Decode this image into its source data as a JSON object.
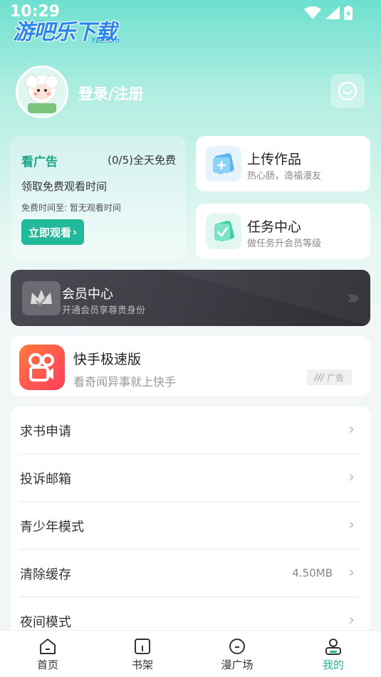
{
  "status": {
    "time": "10:29"
  },
  "watermark": {
    "text": "游吧乐下载",
    "sub": "YBLcom"
  },
  "profile": {
    "login_label": "登录/注册",
    "avatar_text": "小肥羊"
  },
  "ad_card": {
    "title": "看广告",
    "count": "(0/5)全天免费",
    "desc": "领取免费观看时间",
    "time": "免费时间至: 暂无观看时间",
    "button": "立即观看"
  },
  "upload": {
    "title": "上传作品",
    "sub": "热心肠，造福漫友"
  },
  "tasks": {
    "title": "任务中心",
    "sub": "做任务升会员等级"
  },
  "vip": {
    "title": "会员中心",
    "sub": "开通会员享尊贵身份"
  },
  "app_ad": {
    "title": "快手极速版",
    "sub": "看奇闻异事就上快手",
    "tag": "广告"
  },
  "menu": [
    {
      "label": "求书申请",
      "value": ""
    },
    {
      "label": "投诉邮箱",
      "value": ""
    },
    {
      "label": "青少年模式",
      "value": ""
    },
    {
      "label": "清除缓存",
      "value": "4.50MB"
    },
    {
      "label": "夜间模式",
      "value": ""
    }
  ],
  "tabs": [
    {
      "label": "首页",
      "icon": "home-icon",
      "active": false
    },
    {
      "label": "书架",
      "icon": "bookshelf-icon",
      "active": false
    },
    {
      "label": "漫广场",
      "icon": "square-icon",
      "active": false
    },
    {
      "label": "我的",
      "icon": "profile-icon",
      "active": true
    }
  ],
  "colors": {
    "accent": "#22b89a",
    "header_top": "#6ee0cf",
    "vip_bg": "#3e3f46"
  }
}
